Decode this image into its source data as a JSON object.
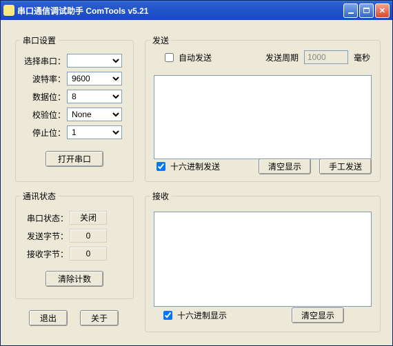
{
  "window": {
    "title": "串口通信调试助手 ComTools v5.21"
  },
  "port_settings": {
    "legend": "串口设置",
    "select_port_label": "选择串口：",
    "select_port_value": "",
    "baud_label": "波特率：",
    "baud_value": "9600",
    "data_bits_label": "数据位：",
    "data_bits_value": "8",
    "parity_label": "校验位：",
    "parity_value": "None",
    "stop_bits_label": "停止位：",
    "stop_bits_value": "1",
    "open_button": "打开串口"
  },
  "comm_status": {
    "legend": "通讯状态",
    "port_state_label": "串口状态：",
    "port_state_value": "关闭",
    "sent_bytes_label": "发送字节：",
    "sent_bytes_value": "0",
    "recv_bytes_label": "接收字节：",
    "recv_bytes_value": "0",
    "clear_count_button": "清除计数"
  },
  "footer": {
    "exit_button": "退出",
    "about_button": "关于"
  },
  "send": {
    "legend": "发送",
    "auto_send_label": "自动发送",
    "period_label": "发送周期",
    "period_value": "1000",
    "period_unit": "毫秒",
    "hex_send_label": "十六进制发送",
    "hex_send_checked": true,
    "clear_display_button": "清空显示",
    "manual_send_button": "手工发送"
  },
  "recv": {
    "legend": "接收",
    "hex_display_label": "十六进制显示",
    "hex_display_checked": true,
    "clear_display_button": "清空显示"
  }
}
